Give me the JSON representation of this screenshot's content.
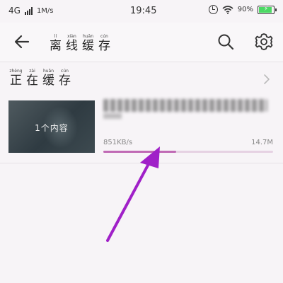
{
  "status_bar": {
    "network": "4G",
    "speed": "1M/s",
    "time": "19:45",
    "battery": "90%",
    "battery_level": 0.9
  },
  "header": {
    "title": [
      {
        "hz": "离",
        "py": "lí"
      },
      {
        "hz": "线",
        "py": "xiàn"
      },
      {
        "hz": "缓",
        "py": "huǎn"
      },
      {
        "hz": "存",
        "py": "cún"
      }
    ]
  },
  "downloading": {
    "section_title": [
      {
        "hz": "正",
        "py": "zhèng"
      },
      {
        "hz": "在",
        "py": "zài"
      },
      {
        "hz": "缓",
        "py": "huǎn"
      },
      {
        "hz": "存",
        "py": "cún"
      }
    ],
    "item": {
      "thumb_label": "1个内容",
      "speed": "851KB/s",
      "size": "14.7M",
      "progress": 0.43
    }
  },
  "colors": {
    "accent": "#c06ab5",
    "annotation": "#a020c8"
  },
  "icons": [
    "back-arrow-icon",
    "search-icon",
    "gear-icon",
    "chevron-right-icon",
    "alarm-icon",
    "wifi-icon",
    "battery-icon",
    "signal-icon"
  ]
}
